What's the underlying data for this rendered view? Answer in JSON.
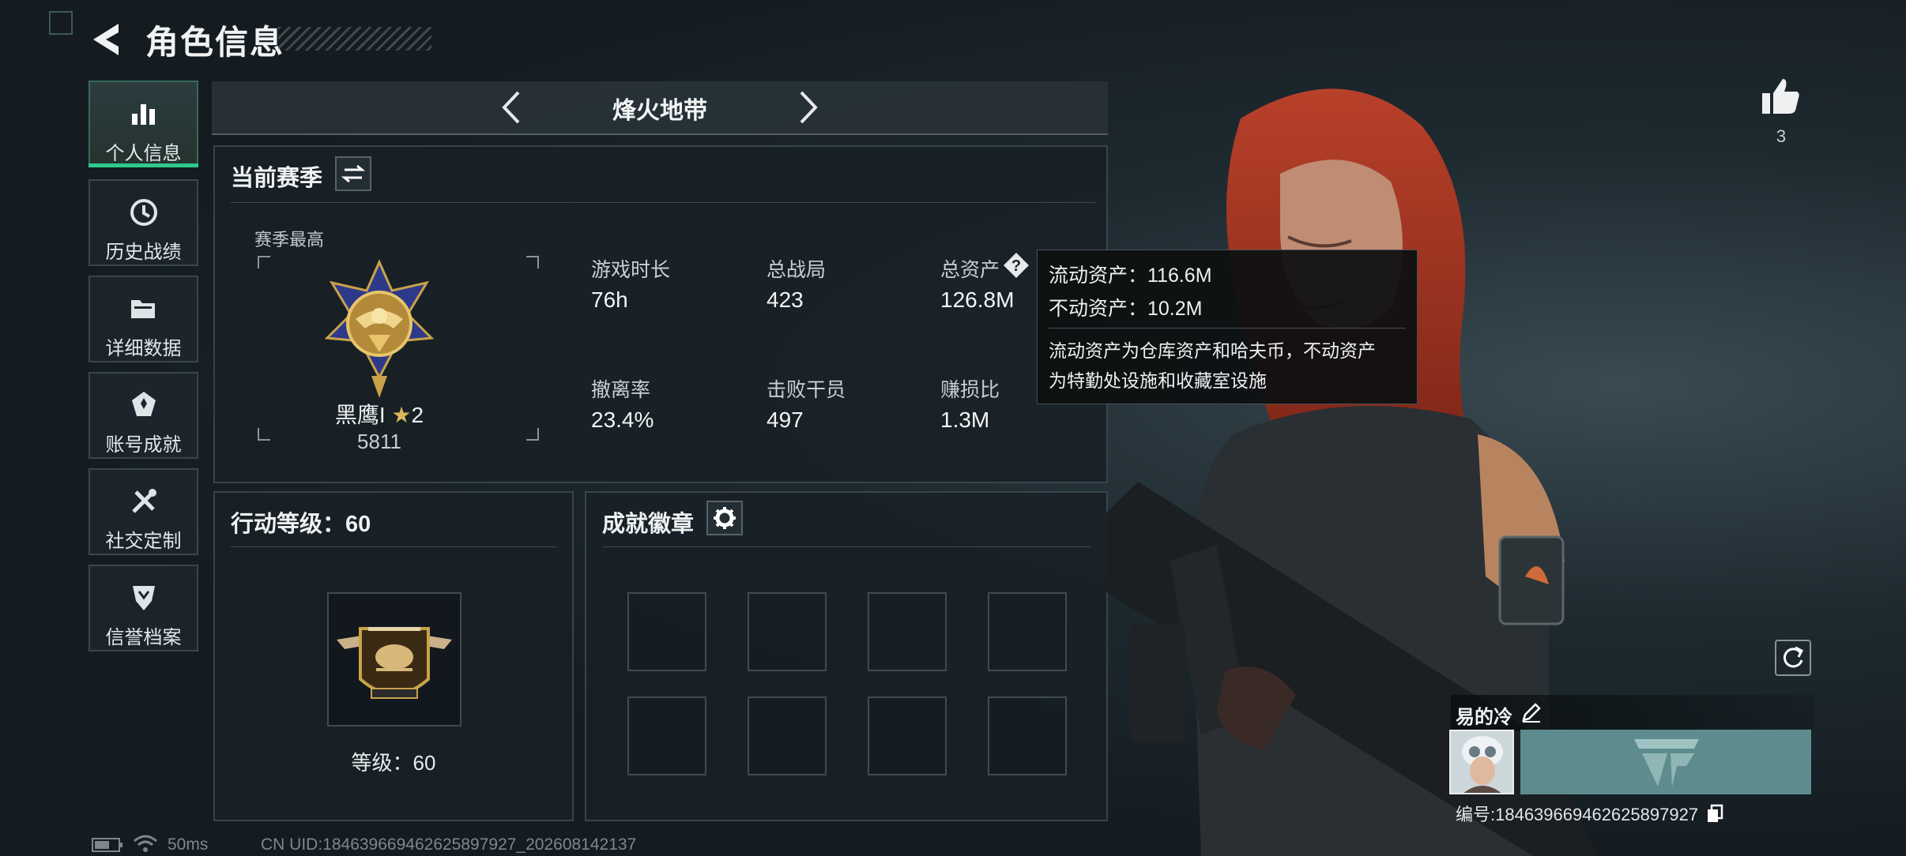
{
  "header": {
    "title": "角色信息"
  },
  "sidebar": {
    "items": [
      {
        "label": "个人信息",
        "icon": "bar-chart-icon",
        "active": true
      },
      {
        "label": "历史战绩",
        "icon": "history-clock-icon",
        "active": false
      },
      {
        "label": "详细数据",
        "icon": "folder-icon",
        "active": false
      },
      {
        "label": "账号成就",
        "icon": "achievement-badge-icon",
        "active": false
      },
      {
        "label": "社交定制",
        "icon": "tools-icon",
        "active": false
      },
      {
        "label": "信誉档案",
        "icon": "shield-chevron-icon",
        "active": false
      }
    ]
  },
  "mode_selector": {
    "title": "烽火地带"
  },
  "season": {
    "title": "当前赛季",
    "best_label": "赛季最高",
    "rank_name": "黑鹰I",
    "rank_stars": "2",
    "rank_score": "5811",
    "stats": [
      {
        "label": "游戏时长",
        "value": "76h"
      },
      {
        "label": "总战局",
        "value": "423"
      },
      {
        "label": "总资产",
        "value": "126.8M"
      },
      {
        "label": "撤离率",
        "value": "23.4%"
      },
      {
        "label": "击败干员",
        "value": "497"
      },
      {
        "label": "赚损比",
        "value": "1.3M"
      }
    ]
  },
  "tooltip": {
    "liquid": "流动资产：116.6M",
    "fixed": "不动资产：10.2M",
    "desc_line1": "流动资产为仓库资产和哈夫币，不动资产",
    "desc_line2": "为特勤处设施和收藏室设施"
  },
  "action_level": {
    "title": "行动等级：60",
    "level_label": "等级：60"
  },
  "achievements": {
    "title": "成就徽章",
    "slot_count": 8
  },
  "like": {
    "count": "3"
  },
  "profile": {
    "name": "易的冷",
    "id_label": "编号:1846396694626258979​27"
  },
  "status": {
    "ping": "50ms",
    "uid": "CN UID:1846396694626258979​27_202608142137"
  },
  "colors": {
    "accent": "#2ec98a",
    "panel_border": "#38444b",
    "tooltip_bg": "#0e1011"
  }
}
